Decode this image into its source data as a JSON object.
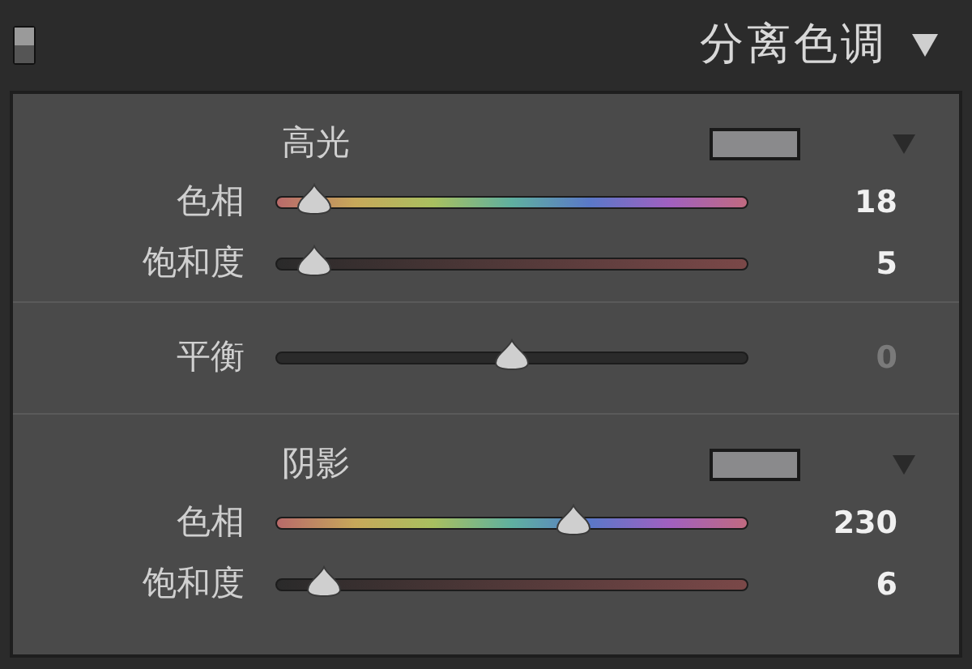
{
  "panel": {
    "title": "分离色调",
    "enabled": true
  },
  "sections": [
    {
      "kind": "group",
      "heading": "高光",
      "sliders": [
        {
          "label": "色相",
          "kind": "hue",
          "level": 0.08,
          "reading": "18"
        },
        {
          "label": "饱和度",
          "kind": "saturation",
          "level": 0.08,
          "reading": "5"
        }
      ]
    },
    {
      "kind": "balance",
      "sliders": [
        {
          "label": "平衡",
          "kind": "plain",
          "level": 0.5,
          "reading": "0"
        }
      ]
    },
    {
      "kind": "group",
      "heading": "阴影",
      "sliders": [
        {
          "label": "色相",
          "kind": "hue",
          "level": 0.63,
          "reading": "230"
        },
        {
          "label": "饱和度",
          "kind": "saturation",
          "level": 0.1,
          "reading": "6"
        }
      ]
    }
  ]
}
